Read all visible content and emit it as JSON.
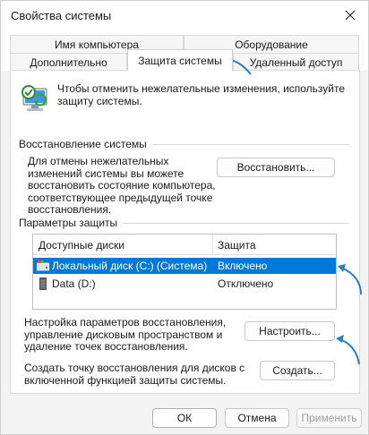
{
  "window": {
    "title": "Свойства системы"
  },
  "tabs": {
    "computer_name": "Имя компьютера",
    "hardware": "Оборудование",
    "advanced": "Дополнительно",
    "system_protection": "Защита системы",
    "remote": "Удаленный доступ"
  },
  "intro": {
    "text": "Чтобы отменить нежелательные изменения, используйте защиту системы."
  },
  "restore": {
    "group_title": "Восстановление системы",
    "text": "Для отмены нежелательных изменений системы вы можете восстановить состояние компьютера, соответствующее предыдущей точке восстановления.",
    "button": "Восстановить..."
  },
  "protection": {
    "group_title": "Параметры защиты",
    "columns": {
      "drives": "Доступные диски",
      "protection": "Защита"
    },
    "drives": [
      {
        "name": "Локальный диск (C:) (Система)",
        "status": "Включено",
        "selected": true
      },
      {
        "name": "Data (D:)",
        "status": "Отключено",
        "selected": false
      }
    ],
    "configure_text": "Настройка параметров восстановления, управление дисковым пространством и удаление точек восстановления.",
    "configure_button": "Настроить...",
    "create_text": "Создать точку восстановления для дисков с включенной функцией защиты системы.",
    "create_button": "Создать..."
  },
  "footer": {
    "ok": "ОК",
    "cancel": "Отмена",
    "apply": "Применить"
  },
  "colors": {
    "selection": "#0078d7",
    "annotation_arrow": "#2a7fc0"
  },
  "icons": {
    "close": "close-icon",
    "intro": "system-protection-icon",
    "system_drive": "system-drive-icon",
    "data_drive": "drive-icon"
  }
}
